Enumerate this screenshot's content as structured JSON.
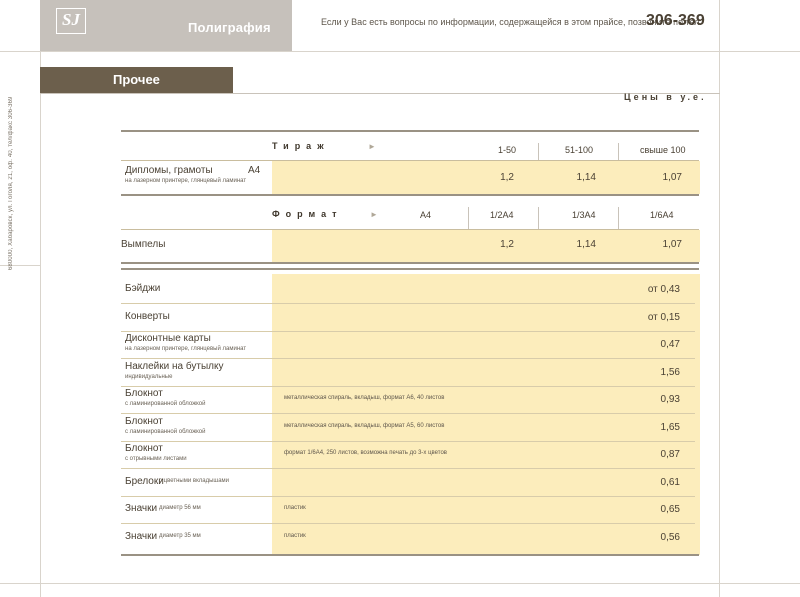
{
  "header": {
    "logo_text": "SJ",
    "brand": "Полиграфия",
    "contact_text": "Если у Вас есть вопросы по информации, содержащейся в этом прайсе, позвоните по тел.",
    "phone": "306-369"
  },
  "sidebar_text": "680000, Хабаровск, ул. Гоголя, 21, оф. 40, тел/факс 306-369",
  "section": {
    "title": "Прочее",
    "currency_note": "Цены в у.е."
  },
  "tirazh": {
    "header": "Тираж",
    "arrow": "►",
    "columns": [
      "1-50",
      "51-100",
      "свыше 100"
    ],
    "row": {
      "label": "Дипломы, грамоты",
      "format": "А4",
      "sub": "на лазерном принтере, глянцевый ламинат",
      "values": [
        "1,2",
        "1,14",
        "1,07"
      ]
    }
  },
  "format": {
    "header": "Формат",
    "arrow": "►",
    "columns": [
      "А4",
      "1/2А4",
      "1/3А4",
      "1/6А4"
    ],
    "row": {
      "label": "Вымпелы",
      "values": [
        "1,2",
        "1,14",
        "1,07"
      ]
    }
  },
  "items": [
    {
      "label": "Бэйджи",
      "sub": "",
      "note": "",
      "price": "от 0,43"
    },
    {
      "label": "Конверты",
      "sub": "",
      "note": "",
      "price": "от 0,15"
    },
    {
      "label": "Дисконтные карты",
      "sub": "на лазерном принтере, глянцевый ламинат",
      "note": "",
      "price": "0,47"
    },
    {
      "label": "Наклейки на бутылку",
      "sub": "индивидуальные",
      "note": "",
      "price": "1,56"
    },
    {
      "label": "Блокнот",
      "sub": "с ламинированной обложкой",
      "note": "металлическая спираль, вкладыш, формат А6, 40 листов",
      "price": "0,93"
    },
    {
      "label": "Блокнот",
      "sub": "с ламинированной обложкой",
      "note": "металлическая спираль, вкладыш, формат А5, 60 листов",
      "price": "1,65"
    },
    {
      "label": "Блокнот",
      "sub": "с отрывными листами",
      "note": "формат 1/6А4, 250 листов, возможна печать до 3-х цветов",
      "price": "0,87"
    },
    {
      "label": "Брелоки",
      "sub_inline": "с цветными вкладышами",
      "note": "",
      "price": "0,61"
    },
    {
      "label": "Значки",
      "sub_inline": "диаметр 56 мм",
      "note": "пластик",
      "price": "0,65"
    },
    {
      "label": "Значки",
      "sub_inline": "диаметр 35 мм",
      "note": "пластик",
      "price": "0,56"
    }
  ]
}
